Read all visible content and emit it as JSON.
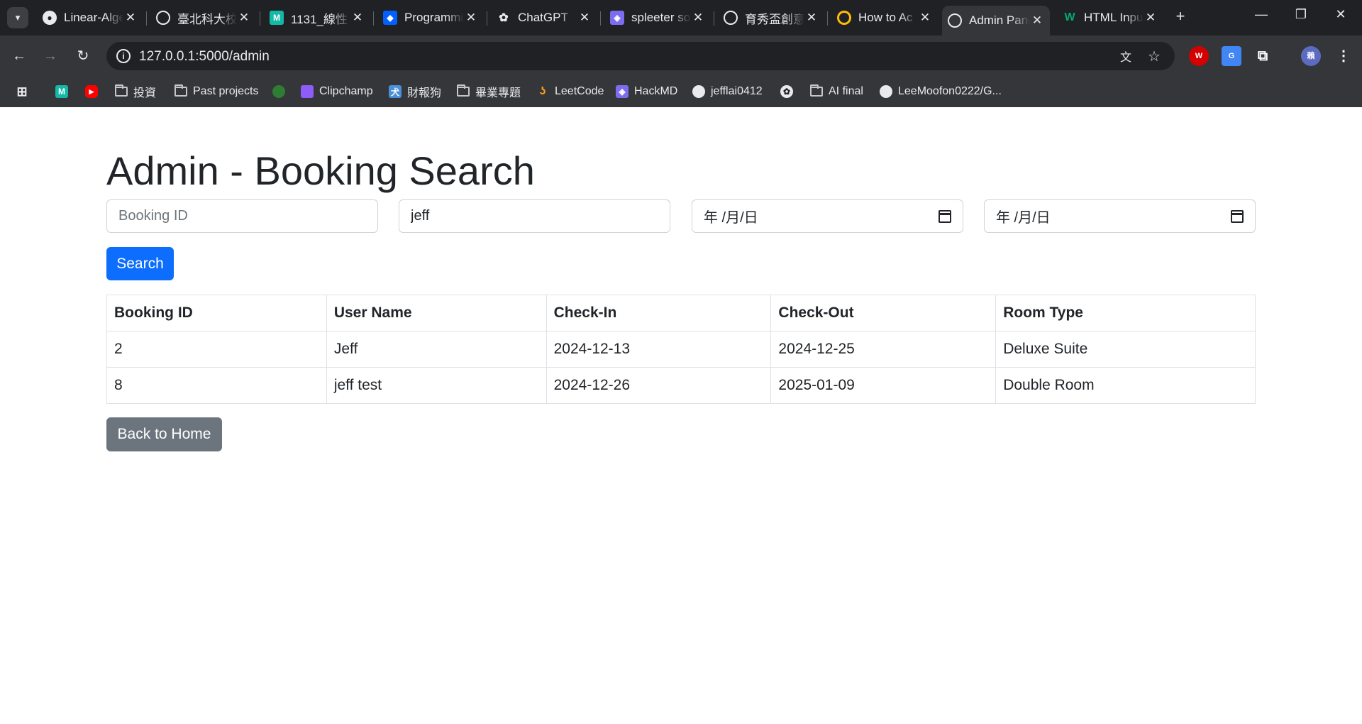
{
  "browser": {
    "tabs": [
      {
        "label": "Linear-Algebra",
        "icon": "github-icon",
        "color": "#e8eaed"
      },
      {
        "label": "臺北科大校",
        "icon": "globe-icon",
        "color": "#e8eaed"
      },
      {
        "label": "1131_線性",
        "icon": "m-logo-icon",
        "color": "#14b8a6"
      },
      {
        "label": "Programming",
        "icon": "dropbox-icon",
        "color": "#0061fe"
      },
      {
        "label": "ChatGPT",
        "icon": "openai-icon",
        "color": "#e8eaed"
      },
      {
        "label": "spleeter so",
        "icon": "hackmd-icon",
        "color": "#7c6cf0"
      },
      {
        "label": "育秀盃創意",
        "icon": "globe-icon",
        "color": "#e8eaed"
      },
      {
        "label": "How to Ac",
        "icon": "colab-icon",
        "color": "#fbbc04"
      },
      {
        "label": "Admin Panel",
        "icon": "globe-icon",
        "color": "#e8eaed"
      },
      {
        "label": "HTML Input",
        "icon": "w3-icon",
        "color": "#04aa6d"
      }
    ],
    "active_tab": 8,
    "url": "127.0.0.1:5000/admin",
    "bookmarks": [
      {
        "label": "",
        "icon": "m-logo-icon"
      },
      {
        "label": "",
        "icon": "youtube-icon"
      },
      {
        "label": "投資",
        "icon": "folder-icon"
      },
      {
        "label": "Past projects",
        "icon": "folder-icon"
      },
      {
        "label": "",
        "icon": "tree-icon"
      },
      {
        "label": "Clipchamp",
        "icon": "clipchamp-icon"
      },
      {
        "label": "財報狗",
        "icon": "caibaogou-icon"
      },
      {
        "label": "畢業專題",
        "icon": "folder-icon"
      },
      {
        "label": "LeetCode",
        "icon": "leetcode-icon"
      },
      {
        "label": "HackMD",
        "icon": "hackmd-icon"
      },
      {
        "label": "jefflai0412",
        "icon": "github-icon"
      },
      {
        "label": "",
        "icon": "openai-icon"
      },
      {
        "label": "AI final",
        "icon": "folder-icon"
      },
      {
        "label": "LeeMoofon0222/G...",
        "icon": "github-icon"
      }
    ],
    "profile_initial": "賴"
  },
  "page": {
    "title": "Admin - Booking Search",
    "filters": {
      "booking_id_placeholder": "Booking ID",
      "user_name_value": "jeff",
      "check_in_value": "年 /月/日",
      "check_out_value": "年 /月/日"
    },
    "search_label": "Search",
    "table": {
      "headers": [
        "Booking ID",
        "User Name",
        "Check-In",
        "Check-Out",
        "Room Type"
      ],
      "rows": [
        [
          "2",
          "Jeff",
          "2024-12-13",
          "2024-12-25",
          "Deluxe Suite"
        ],
        [
          "8",
          "jeff test",
          "2024-12-26",
          "2025-01-09",
          "Double Room"
        ]
      ]
    },
    "back_label": "Back to Home"
  }
}
